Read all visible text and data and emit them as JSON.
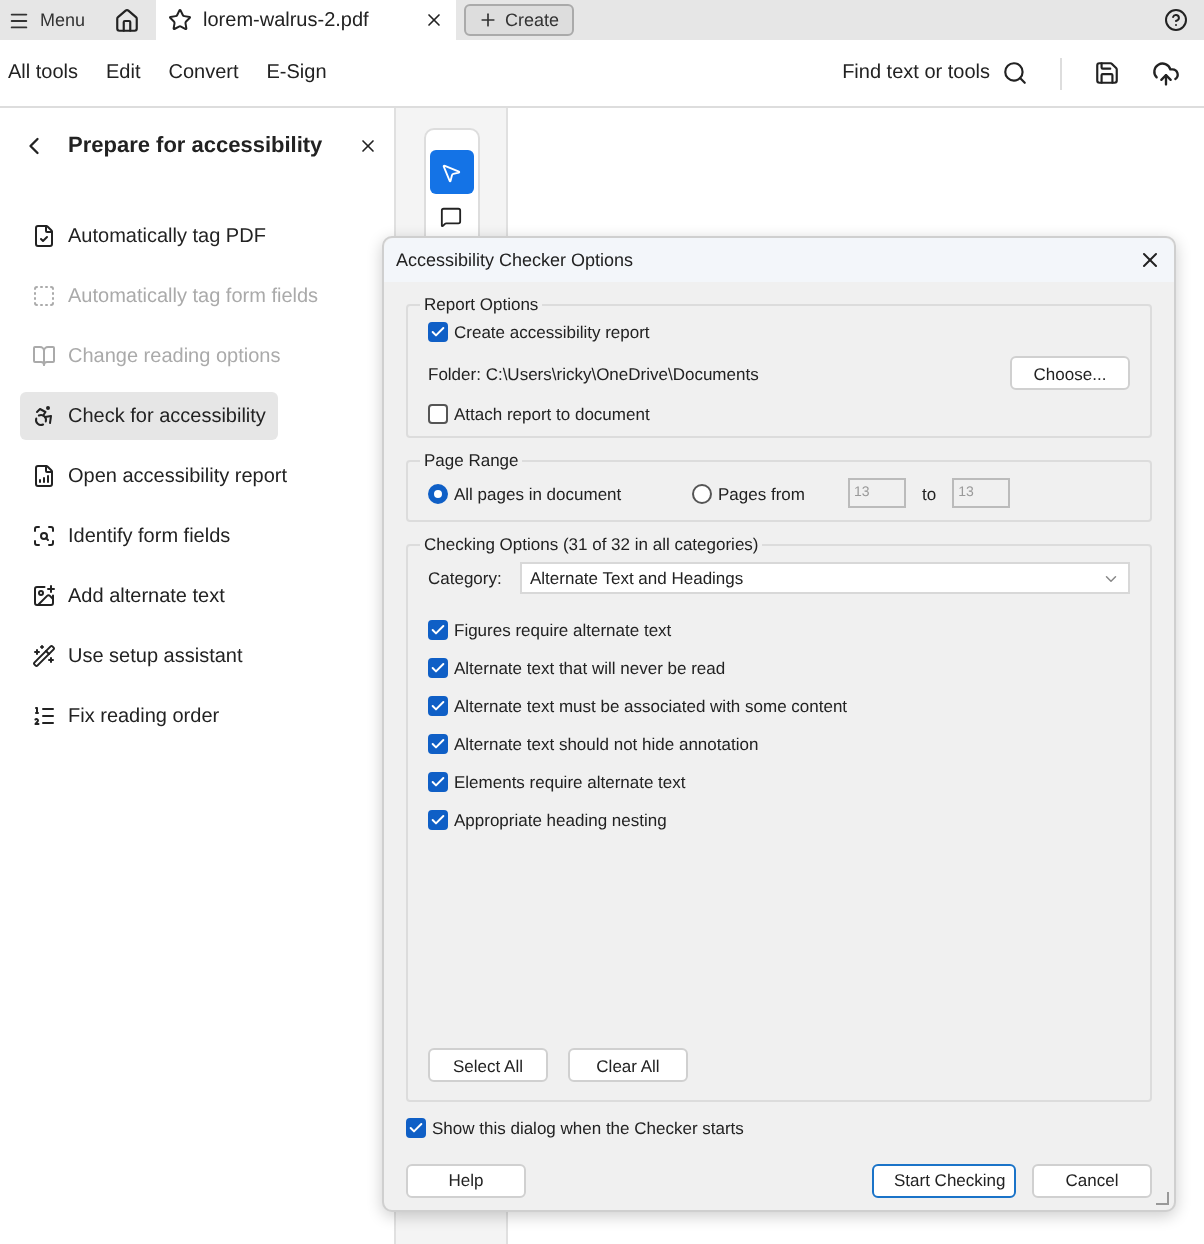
{
  "tabbar": {
    "menu": "Menu",
    "document_tab": "lorem-walrus-2.pdf",
    "create": "Create"
  },
  "toolbar": {
    "items": [
      "All tools",
      "Edit",
      "Convert",
      "E-Sign"
    ],
    "search": "Find text or tools"
  },
  "sidebar": {
    "title": "Prepare for accessibility",
    "items": [
      {
        "kind": "tag",
        "label": "Automatically tag PDF",
        "disabled": false,
        "selected": false
      },
      {
        "kind": "form",
        "label": "Automatically tag form fields",
        "disabled": true,
        "selected": false
      },
      {
        "kind": "book",
        "label": "Change reading options",
        "disabled": true,
        "selected": false
      },
      {
        "kind": "check",
        "label": "Check for accessibility",
        "disabled": false,
        "selected": true
      },
      {
        "kind": "report",
        "label": "Open accessibility report",
        "disabled": false,
        "selected": false
      },
      {
        "kind": "fields",
        "label": "Identify form fields",
        "disabled": false,
        "selected": false
      },
      {
        "kind": "image",
        "label": "Add alternate text",
        "disabled": false,
        "selected": false
      },
      {
        "kind": "wand",
        "label": "Use setup assistant",
        "disabled": false,
        "selected": false
      },
      {
        "kind": "order",
        "label": "Fix reading order",
        "disabled": false,
        "selected": false
      }
    ]
  },
  "dialog": {
    "title": "Accessibility Checker Options",
    "report_options": {
      "legend": "Report Options",
      "create_report": {
        "label": "Create accessibility report",
        "checked": true
      },
      "folder": "Folder: C:\\Users\\ricky\\OneDrive\\Documents",
      "choose": "Choose...",
      "attach": {
        "label": "Attach report to document",
        "checked": false
      }
    },
    "page_range": {
      "legend": "Page Range",
      "options": [
        {
          "label": "All pages in document",
          "selected": true
        },
        {
          "label": "Pages from",
          "selected": false
        }
      ],
      "from": "13",
      "to_label": "to",
      "to": "13"
    },
    "checking_options": {
      "legend": "Checking Options (31 of 32 in all categories)",
      "category_label": "Category:",
      "category": "Alternate Text and Headings",
      "rules": [
        {
          "label": "Figures require alternate text",
          "checked": true
        },
        {
          "label": "Alternate text that will never be read",
          "checked": true
        },
        {
          "label": "Alternate text must be associated with some content",
          "checked": true
        },
        {
          "label": "Alternate text should not hide annotation",
          "checked": true
        },
        {
          "label": "Elements require alternate text",
          "checked": true
        },
        {
          "label": "Appropriate heading nesting",
          "checked": true
        }
      ],
      "select_all": "Select All",
      "clear_all": "Clear All"
    },
    "show_dialog": {
      "label": "Show this dialog when the Checker starts",
      "checked": true
    },
    "buttons": [
      {
        "kind": "help",
        "label": "Help"
      },
      {
        "kind": "primary",
        "label": "Start Checking"
      },
      {
        "kind": "cancel",
        "label": "Cancel"
      }
    ]
  }
}
